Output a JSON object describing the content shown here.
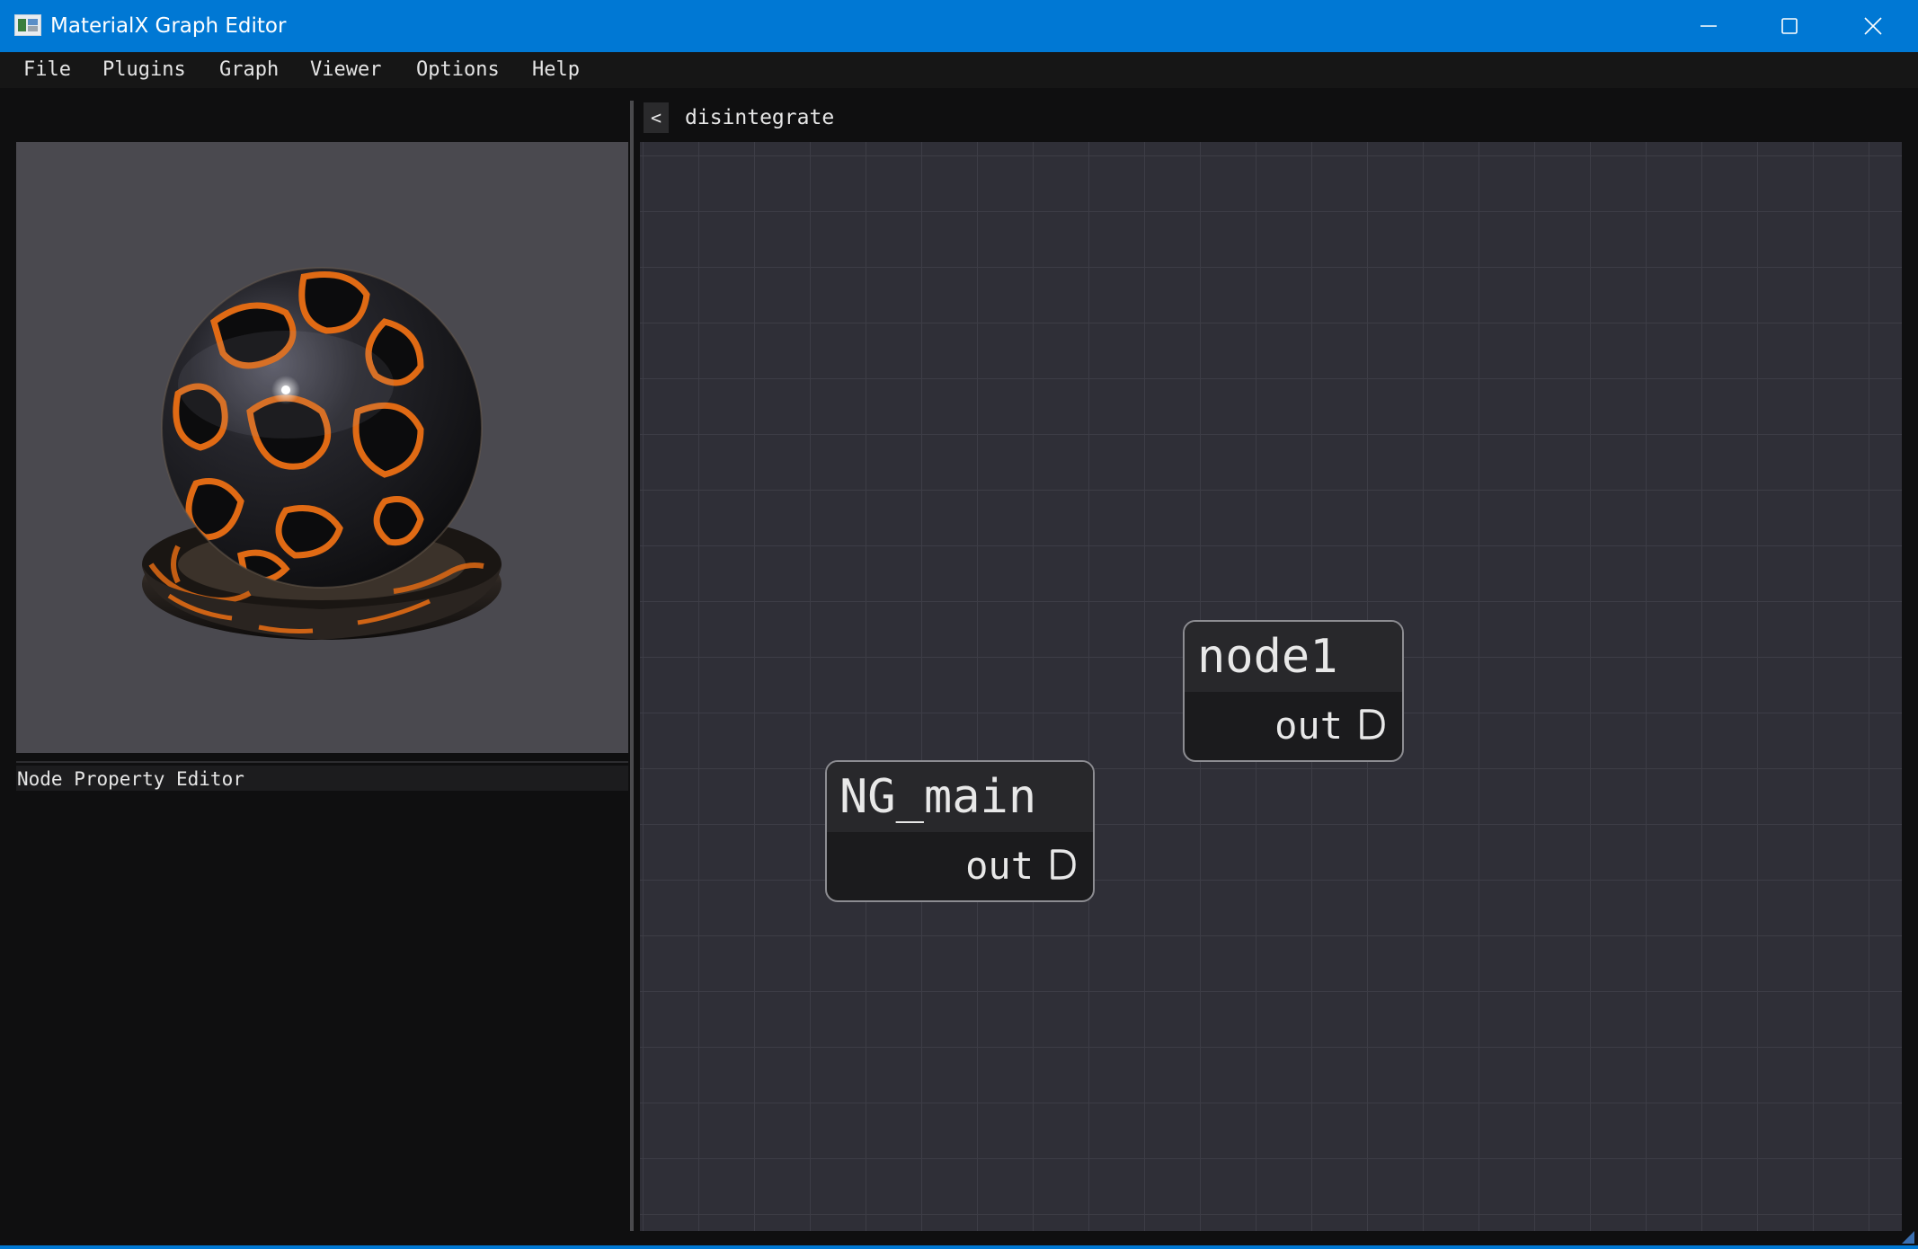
{
  "window": {
    "title": "MaterialX Graph Editor",
    "accent_color": "#0078d4",
    "controls": [
      "minimize-icon",
      "maximize-icon",
      "close-icon"
    ]
  },
  "menu": {
    "items": [
      "File",
      "Plugins",
      "Graph",
      "Viewer",
      "Options",
      "Help"
    ]
  },
  "viewer": {
    "background_color": "#4a494f",
    "material_colors": {
      "base": "#141416",
      "pattern": "#e06a14"
    }
  },
  "property_editor": {
    "title": "Node Property Editor"
  },
  "graph": {
    "back_label": "<",
    "name": "disintegrate",
    "canvas_color": "#2f2f37",
    "nodes": [
      {
        "title": "NG_main",
        "port": "out"
      },
      {
        "title": "node1",
        "port": "out"
      }
    ]
  }
}
